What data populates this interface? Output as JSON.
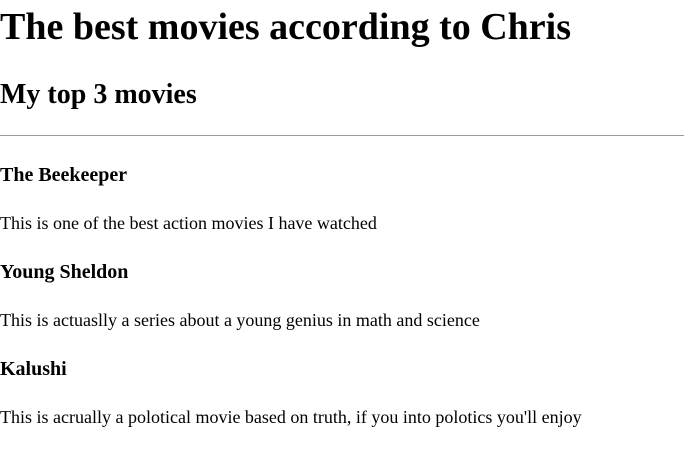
{
  "header": {
    "title": "The best movies according to Chris",
    "subtitle": "My top 3 movies"
  },
  "movies": [
    {
      "title": "The Beekeeper",
      "description": "This is one of the best action movies I have watched"
    },
    {
      "title": "Young Sheldon",
      "description": "This is actuaslly a series about a young genius in math and science"
    },
    {
      "title": "Kalushi",
      "description": "This is acrually a polotical movie based on truth, if you into polotics you'll enjoy"
    }
  ]
}
